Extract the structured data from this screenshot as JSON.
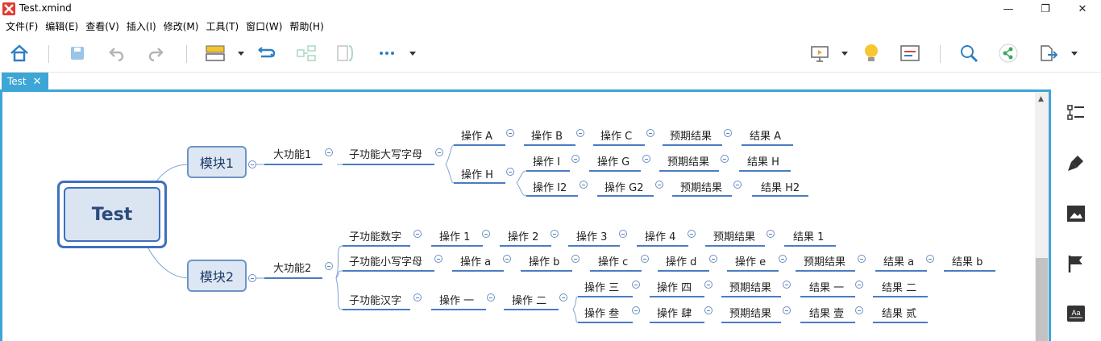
{
  "window": {
    "title": "Test.xmind"
  },
  "menu": [
    "文件(F)",
    "编辑(E)",
    "查看(V)",
    "插入(I)",
    "修改(M)",
    "工具(T)",
    "窗口(W)",
    "帮助(H)"
  ],
  "tabs": [
    {
      "label": "Test"
    }
  ],
  "map": {
    "central": "Test",
    "module1": "模块1",
    "module2": "模块2",
    "feature1": "大功能1",
    "feature2": "大功能2",
    "m1": {
      "sub": "子功能大写字母",
      "rowA": [
        "操作 A",
        "操作 B",
        "操作 C",
        "预期结果",
        "结果 A"
      ],
      "opH": "操作 H",
      "rowH1": [
        "操作 I",
        "操作 G",
        "预期结果",
        "结果 H"
      ],
      "rowH2": [
        "操作 I2",
        "操作 G2",
        "预期结果",
        "结果 H2"
      ]
    },
    "m2": {
      "rowNum": [
        "子功能数字",
        "操作 1",
        "操作 2",
        "操作 3",
        "操作 4",
        "预期结果",
        "结果 1"
      ],
      "rowLower": [
        "子功能小写字母",
        "操作 a",
        "操作 b",
        "操作 c",
        "操作 d",
        "操作 e",
        "预期结果",
        "结果 a",
        "结果 b"
      ],
      "rowCn": [
        "子功能汉字",
        "操作 一",
        "操作 二"
      ],
      "rowCn1": [
        "操作 三",
        "操作 四",
        "预期结果",
        "结果 一",
        "结果 二"
      ],
      "rowCn2": [
        "操作 叁",
        "操作 肆",
        "预期结果",
        "结果 壹",
        "结果 贰"
      ]
    }
  },
  "colors": {
    "accent": "#3ea6d6",
    "node_line": "#4a7cc4",
    "central_border": "#3e6fbd"
  },
  "icons": [
    "home-icon",
    "save-icon",
    "undo-icon",
    "redo-icon",
    "insert-topic-icon",
    "relationship-icon",
    "summary-icon",
    "boundary-icon",
    "more-icon",
    "presentation-icon",
    "idea-icon",
    "outline-icon",
    "search-icon",
    "share-icon",
    "export-icon",
    "format-icon",
    "style-icon",
    "image-icon",
    "marker-icon",
    "text-icon"
  ]
}
